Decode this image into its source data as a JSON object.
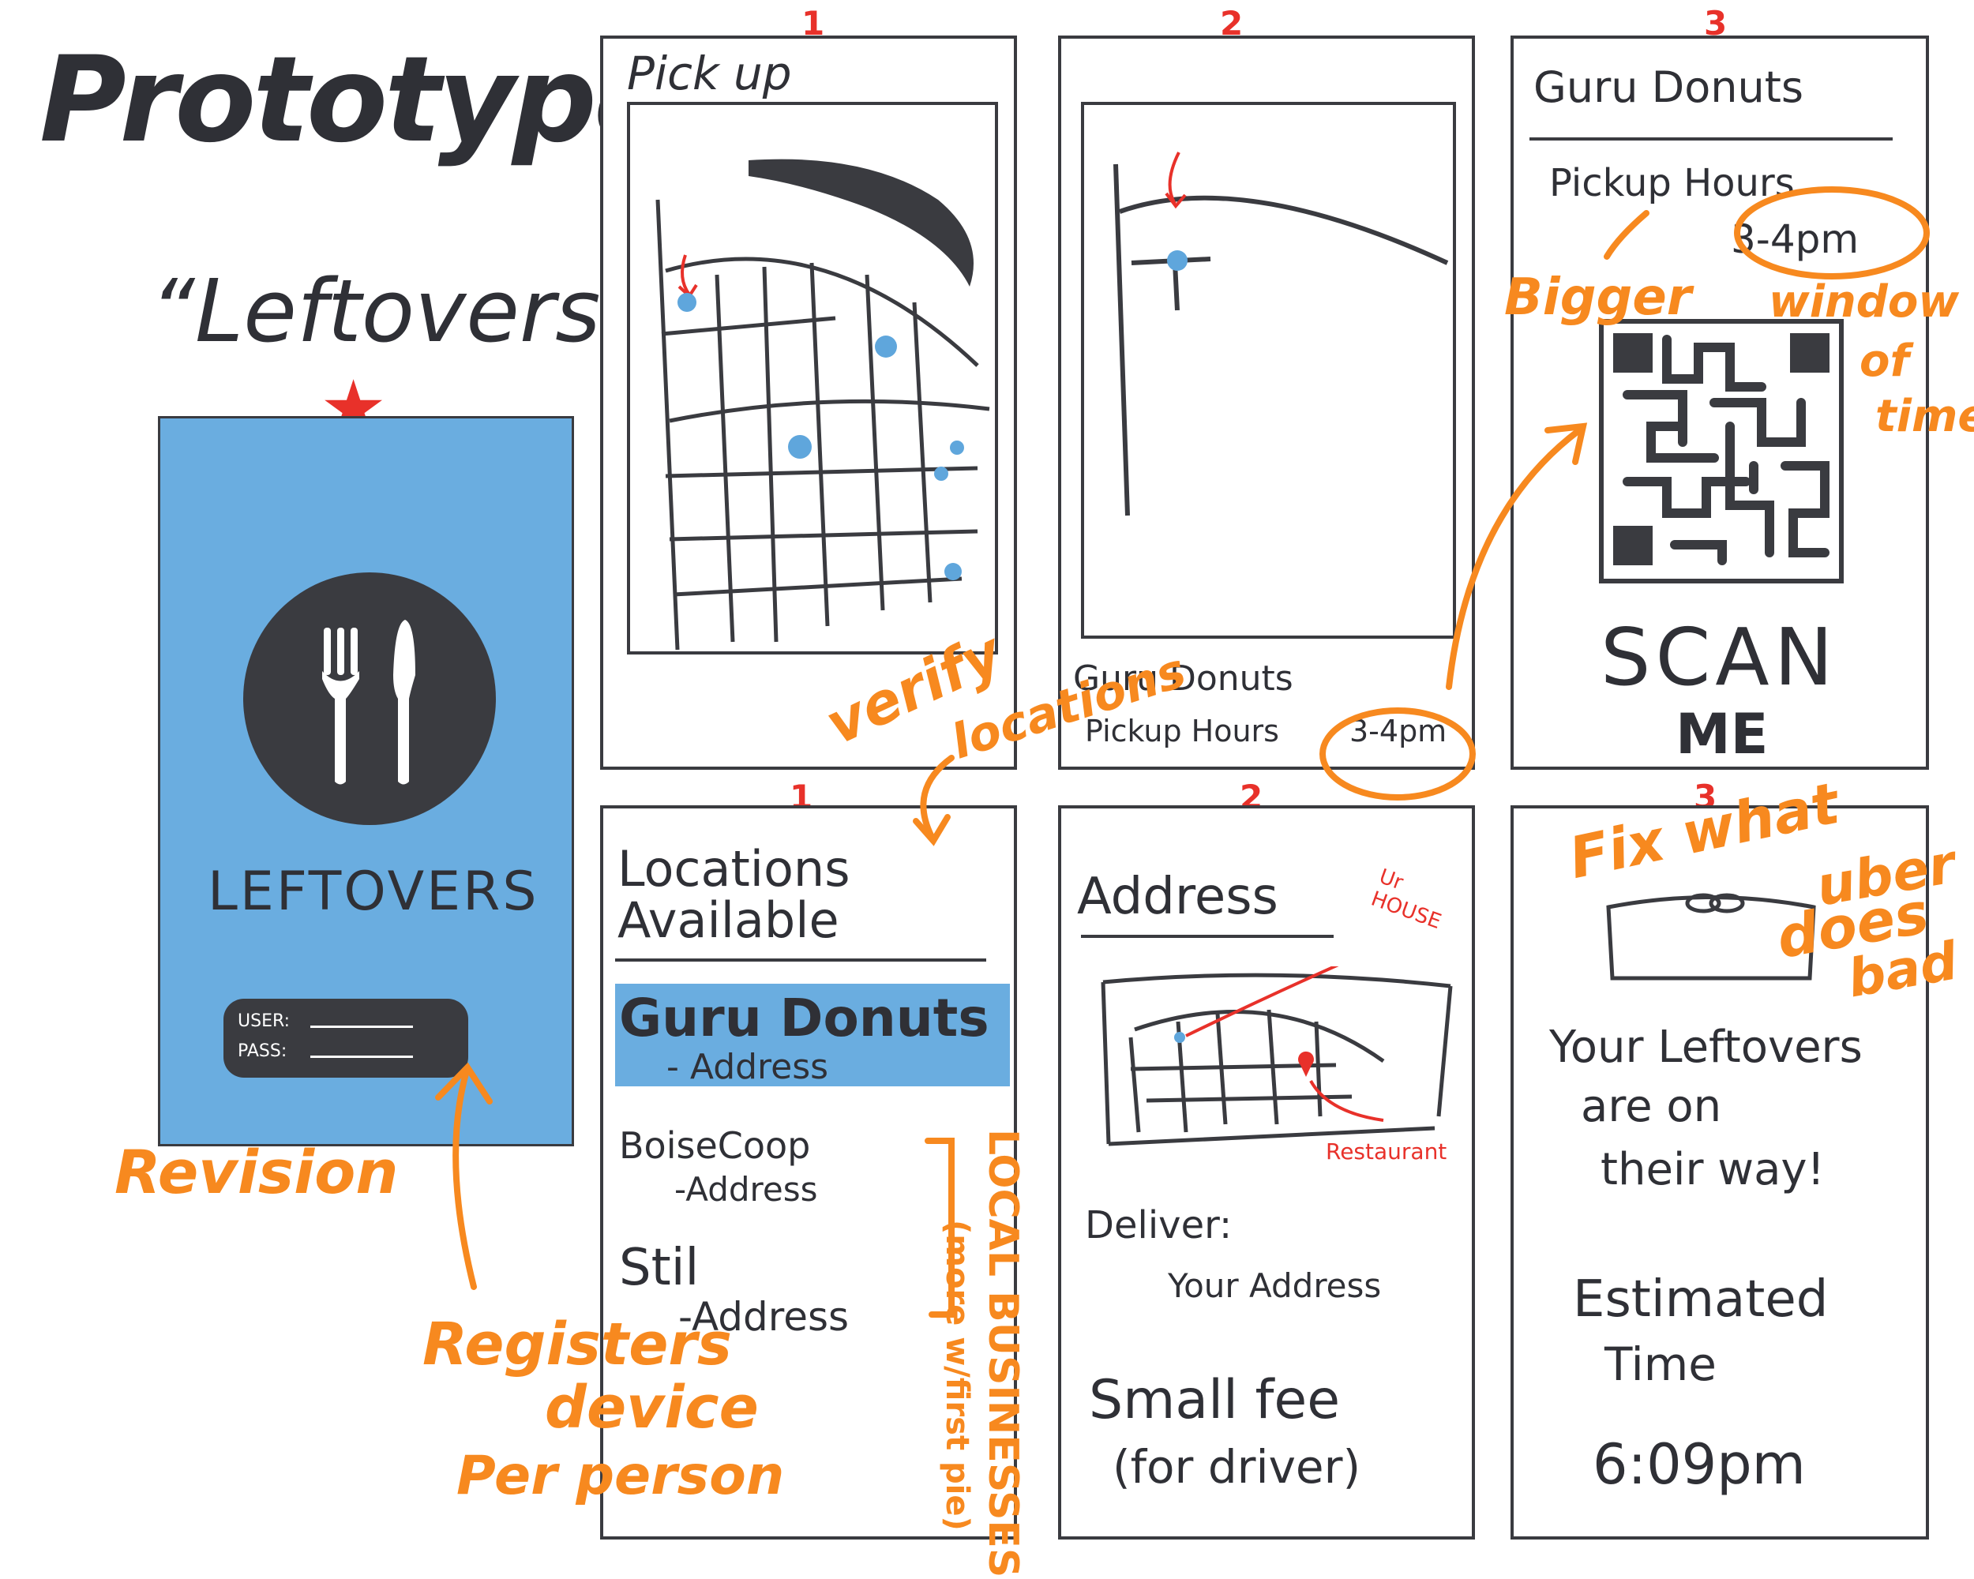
{
  "title": {
    "line1": "Prototype:",
    "line2": "“Leftovers”"
  },
  "login": {
    "app_name": "LEFTOVERS",
    "user_label": "USER:",
    "pass_label": "PASS:",
    "star": "★",
    "bg_color": "#6aade0",
    "dark_color": "#3a3b40"
  },
  "panel_numbers": [
    "1",
    "2",
    "3",
    "1",
    "2",
    "3"
  ],
  "pickup": {
    "title": "Pick up"
  },
  "map2": {
    "store": "Guru Donuts",
    "hours_label": "Pickup Hours",
    "hours": "3-4pm"
  },
  "qr": {
    "store": "Guru Donuts",
    "hours_label": "Pickup Hours",
    "hours": "3-4pm",
    "scan": "SCAN",
    "me": "ME"
  },
  "locations": {
    "title_line1": "Locations",
    "title_line2": "Available",
    "items": [
      {
        "name": "Guru Donuts",
        "sub": "- Address",
        "selected": true
      },
      {
        "name": "BoiseCoop",
        "sub": "-Address",
        "selected": false
      },
      {
        "name": "Stil",
        "sub": "-Address",
        "selected": false
      }
    ]
  },
  "address": {
    "title": "Address",
    "house_label": "Ur HOUSE",
    "restaurant_label": "Restaurant",
    "deliver_label": "Deliver:",
    "deliver_value": "Your Address",
    "fee_line1": "Small fee",
    "fee_line2": "(for driver)"
  },
  "delivery": {
    "msg_line1": "Your Leftovers",
    "msg_line2": "are on",
    "msg_line3": "their way!",
    "est_line1": "Estimated",
    "est_line2": "Time",
    "time": "6:09pm"
  },
  "annotations": {
    "revision": "Revision",
    "registers": "Registers",
    "device": "device",
    "per_person": "Per person",
    "verify": "verify",
    "locations": "locations",
    "bigger": "Bigger",
    "window": "window",
    "of": "of",
    "time": "time",
    "fix": "Fix what",
    "uber": "uber",
    "does": "does",
    "bad": "bad",
    "local_businesses": "LOCAL BUSINESSES",
    "more_with_first": "(more w/first pie)"
  }
}
